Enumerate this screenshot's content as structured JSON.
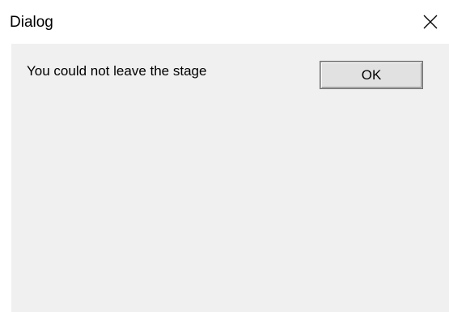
{
  "window": {
    "title": "Dialog",
    "close_icon": "close-icon"
  },
  "dialog": {
    "message": "You could not leave the stage",
    "ok_label": "OK"
  },
  "colors": {
    "titlebar_bg": "#ffffff",
    "client_bg": "#f0f0f0",
    "button_bg": "#e1e1e1",
    "button_border": "#adadad"
  }
}
